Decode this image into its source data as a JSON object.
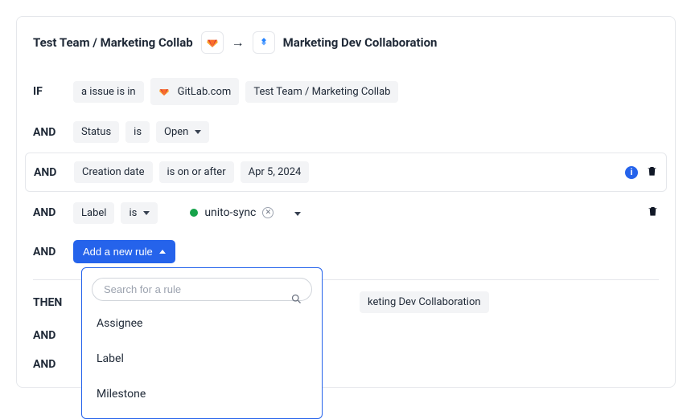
{
  "header": {
    "source_project": "Test Team / Marketing Collab",
    "target_project": "Marketing Dev Collaboration"
  },
  "keywords": {
    "if": "IF",
    "and": "AND",
    "then": "THEN"
  },
  "rows": {
    "if_row": {
      "issue_text": "a issue is in",
      "tool": "GitLab.com",
      "project": "Test Team / Marketing Collab"
    },
    "status_row": {
      "field": "Status",
      "operator": "is",
      "value": "Open"
    },
    "date_row": {
      "field": "Creation date",
      "operator": "is on or after",
      "value": "Apr 5, 2024"
    },
    "label_row": {
      "field": "Label",
      "operator": "is",
      "tag": "unito-sync",
      "tag_color": "#16a34a"
    }
  },
  "add_rule": {
    "button_label": "Add a new rule",
    "search_placeholder": "Search for a rule",
    "options": [
      "Assignee",
      "Label",
      "Milestone"
    ]
  },
  "then_section": {
    "partial_chip": "keting Dev Collaboration"
  }
}
